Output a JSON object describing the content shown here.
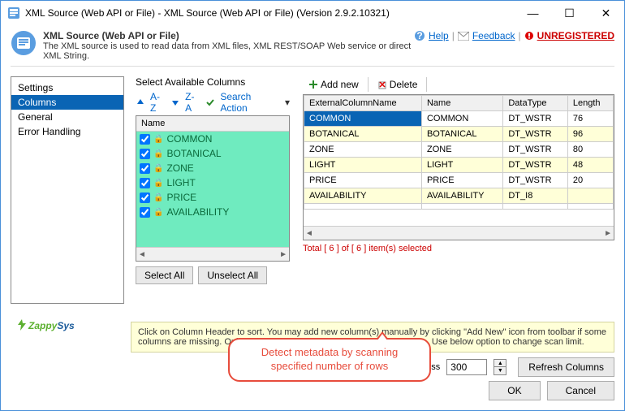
{
  "window": {
    "title": "XML Source (Web API or File) - XML Source (Web API or File) (Version 2.9.2.10321)"
  },
  "header": {
    "title": "XML Source (Web API or File)",
    "subtitle": "The XML source is used to read data from XML files, XML REST/SOAP Web service or direct XML String.",
    "help": "Help",
    "feedback": "Feedback",
    "unregistered": "UNREGISTERED"
  },
  "sidebar": {
    "items": [
      {
        "label": "Settings",
        "active": false
      },
      {
        "label": "Columns",
        "active": true
      },
      {
        "label": "General",
        "active": false
      },
      {
        "label": "Error Handling",
        "active": false
      }
    ]
  },
  "columns_panel": {
    "label": "Select Available Columns",
    "sort_az": "A-Z",
    "sort_za": "Z-A",
    "search_action": "Search Action",
    "header": "Name",
    "items": [
      "COMMON",
      "BOTANICAL",
      "ZONE",
      "LIGHT",
      "PRICE",
      "AVAILABILITY"
    ],
    "select_all": "Select All",
    "unselect_all": "Unselect All"
  },
  "grid_toolbar": {
    "add_new": "Add new",
    "delete": "Delete"
  },
  "grid": {
    "headers": [
      "ExternalColumnName",
      "Name",
      "DataType",
      "Length"
    ],
    "rows": [
      {
        "cells": [
          "COMMON",
          "COMMON",
          "DT_WSTR",
          "76"
        ],
        "selected": true,
        "alt": false
      },
      {
        "cells": [
          "BOTANICAL",
          "BOTANICAL",
          "DT_WSTR",
          "96"
        ],
        "selected": false,
        "alt": true
      },
      {
        "cells": [
          "ZONE",
          "ZONE",
          "DT_WSTR",
          "80"
        ],
        "selected": false,
        "alt": false
      },
      {
        "cells": [
          "LIGHT",
          "LIGHT",
          "DT_WSTR",
          "48"
        ],
        "selected": false,
        "alt": true
      },
      {
        "cells": [
          "PRICE",
          "PRICE",
          "DT_WSTR",
          "20"
        ],
        "selected": false,
        "alt": false
      },
      {
        "cells": [
          "AVAILABILITY",
          "AVAILABILITY",
          "DT_I8",
          ""
        ],
        "selected": false,
        "alt": true
      },
      {
        "cells": [
          "",
          "",
          "",
          ""
        ],
        "selected": false,
        "alt": false
      }
    ],
    "status": "Total [ 6 ] of [ 6 ] item(s) selected"
  },
  "hint": "Click on Column Header to sort. You may add new column(s) manually by clicking \"Add New\" icon from toolbar if some columns are missing. Only limited rows were scanned to detect metadata. Use below option to change scan limit.",
  "scan": {
    "label": "Total rows to scan for datatype guess",
    "value": "300",
    "refresh": "Refresh Columns"
  },
  "callout": "Detect metadata by scanning specified number of rows",
  "buttons": {
    "ok": "OK",
    "cancel": "Cancel"
  },
  "logo": {
    "part1": "Zappy",
    "part2": "Sys"
  }
}
